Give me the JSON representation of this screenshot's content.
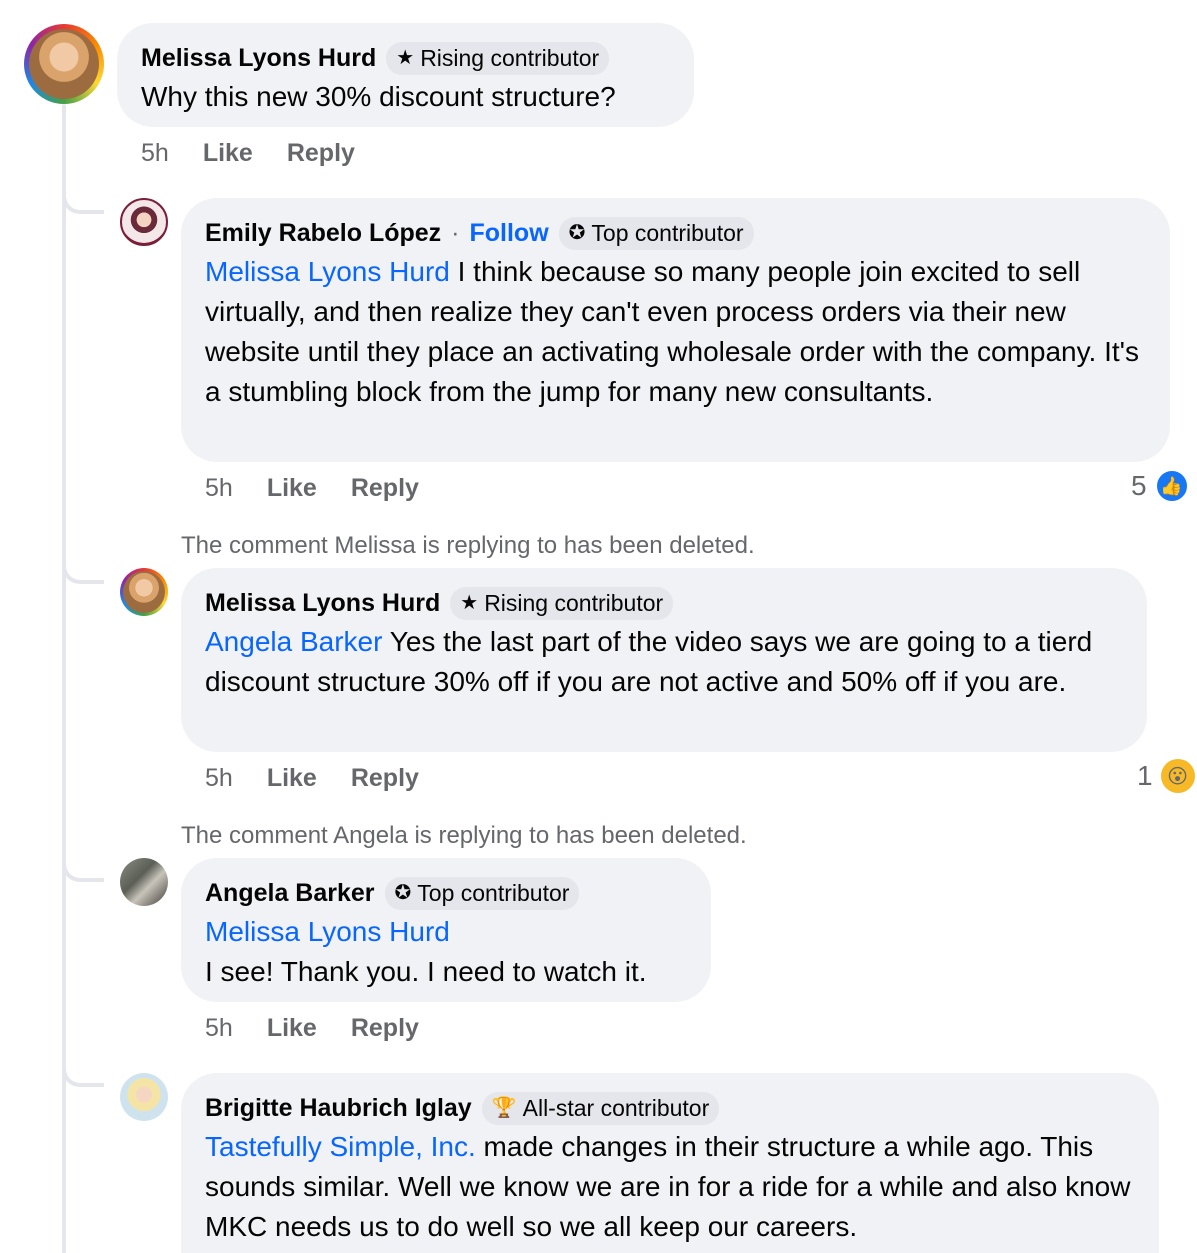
{
  "comments": {
    "c1": {
      "author": "Melissa Lyons Hurd",
      "badge": "Rising contributor",
      "text": "Why this new 30% discount structure?",
      "time": "5h",
      "like": "Like",
      "reply": "Reply"
    },
    "c2": {
      "author": "Emily Rabelo López",
      "separator": "·",
      "follow": "Follow",
      "badge": "Top contributor",
      "mention": "Melissa Lyons Hurd",
      "text": " I think because so many people join excited to sell virtually, and then realize they can't even process orders via their new website until they place an activating wholesale order with the company. It's a stumbling block from the jump for many new consultants.",
      "time": "5h",
      "like": "Like",
      "reply": "Reply",
      "reaction_count": "5",
      "reaction_icon": "like-icon"
    },
    "deleted1": "The comment Melissa is replying to has been deleted.",
    "c3": {
      "author": "Melissa Lyons Hurd",
      "badge": "Rising contributor",
      "mention": "Angela Barker",
      "text": " Yes the last part of the video says we are going to a tierd discount structure 30% off if you are not active and 50% off if you are.",
      "time": "5h",
      "like": "Like",
      "reply": "Reply",
      "reaction_count": "1",
      "reaction_icon": "wow-icon"
    },
    "deleted2": "The comment Angela is replying to has been deleted.",
    "c4": {
      "author": "Angela Barker",
      "badge": "Top contributor",
      "mention": "Melissa Lyons Hurd",
      "text": "I see! Thank you. I need to watch it.",
      "time": "5h",
      "like": "Like",
      "reply": "Reply"
    },
    "c5": {
      "author": "Brigitte Haubrich Iglay",
      "badge": "All-star contributor",
      "mention": "Tastefully Simple, Inc.",
      "text": " made changes in their structure a while ago. This sounds similar. Well we know we are in for a ride for a while and also know MKC needs us to do well so we all keep our careers."
    }
  },
  "colors": {
    "link": "#0866ff",
    "bubble": "#f0f2f5",
    "meta": "#65676b"
  }
}
